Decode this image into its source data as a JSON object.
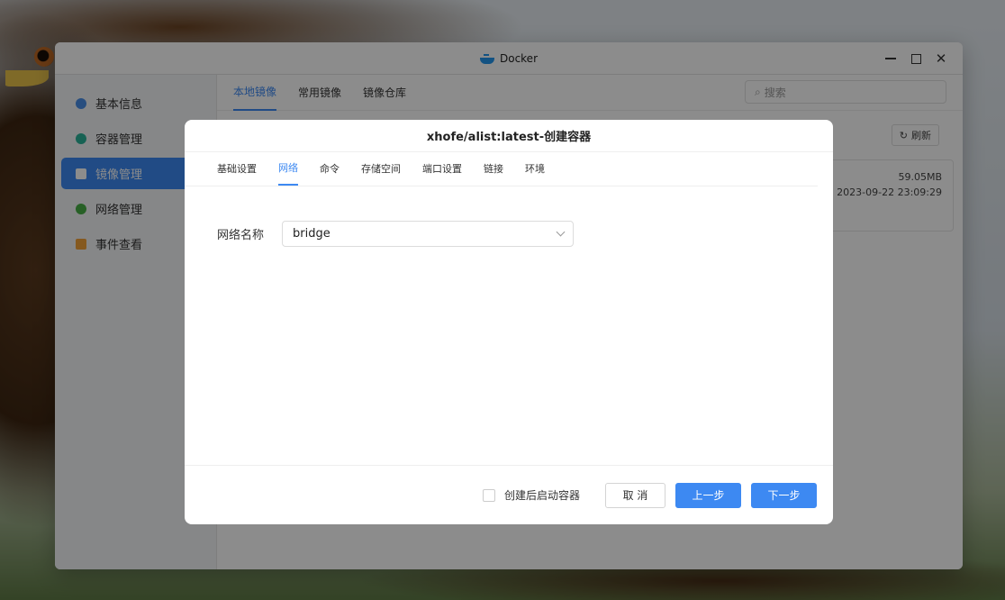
{
  "window": {
    "title": "Docker",
    "controls": [
      "minimize",
      "maximize",
      "close"
    ]
  },
  "sidebar": {
    "items": [
      {
        "label": "基本信息",
        "icon": "info-icon",
        "color": "#4a8fe8",
        "active": false
      },
      {
        "label": "容器管理",
        "icon": "container-icon",
        "color": "#2bb39a",
        "active": false
      },
      {
        "label": "镜像管理",
        "icon": "image-icon",
        "color": "#ffffff",
        "active": true
      },
      {
        "label": "网络管理",
        "icon": "network-icon",
        "color": "#48b045",
        "active": false
      },
      {
        "label": "事件查看",
        "icon": "event-icon",
        "color": "#f2a33a",
        "active": false
      }
    ]
  },
  "main": {
    "tabs": [
      "本地镜像",
      "常用镜像",
      "镜像仓库"
    ],
    "active_tab": "本地镜像",
    "search": {
      "placeholder": "搜索"
    },
    "refresh_label": "刷新",
    "image_card": {
      "size": "59.05MB",
      "date": "2023-09-22 23:09:29"
    }
  },
  "modal": {
    "title": "xhofe/alist:latest-创建容器",
    "tabs": [
      "基础设置",
      "网络",
      "命令",
      "存储空间",
      "端口设置",
      "链接",
      "环境"
    ],
    "active_tab": "网络",
    "network_label": "网络名称",
    "network_value": "bridge",
    "start_after_create_label": "创建后启动容器",
    "start_after_create_checked": false,
    "cancel_label": "取 消",
    "prev_label": "上一步",
    "next_label": "下一步"
  },
  "colors": {
    "accent": "#3d89f2",
    "overlay": "rgba(0,0,0,0.45)"
  }
}
